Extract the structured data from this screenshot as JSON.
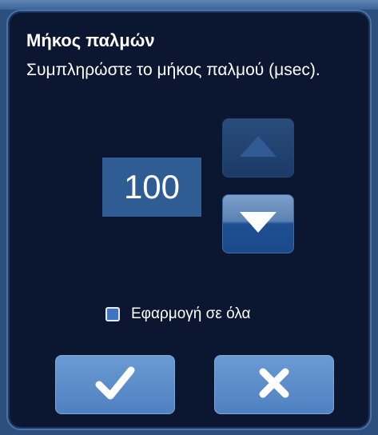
{
  "dialog": {
    "title": "Μήκος παλμών",
    "instruction": "Συμπληρώστε το μήκος παλμού (μsec)."
  },
  "pulse_length": {
    "value": "100",
    "increase_icon": "triangle-up-icon",
    "decrease_icon": "triangle-down-icon"
  },
  "apply_all": {
    "label": "Εφαρμογή σε όλα",
    "checked": true
  },
  "actions": {
    "confirm_icon": "checkmark-icon",
    "cancel_icon": "x-icon"
  },
  "colors": {
    "dialog_background": "#0b1631",
    "value_box": "#2e5c93",
    "action_button": "#5a8bca"
  }
}
